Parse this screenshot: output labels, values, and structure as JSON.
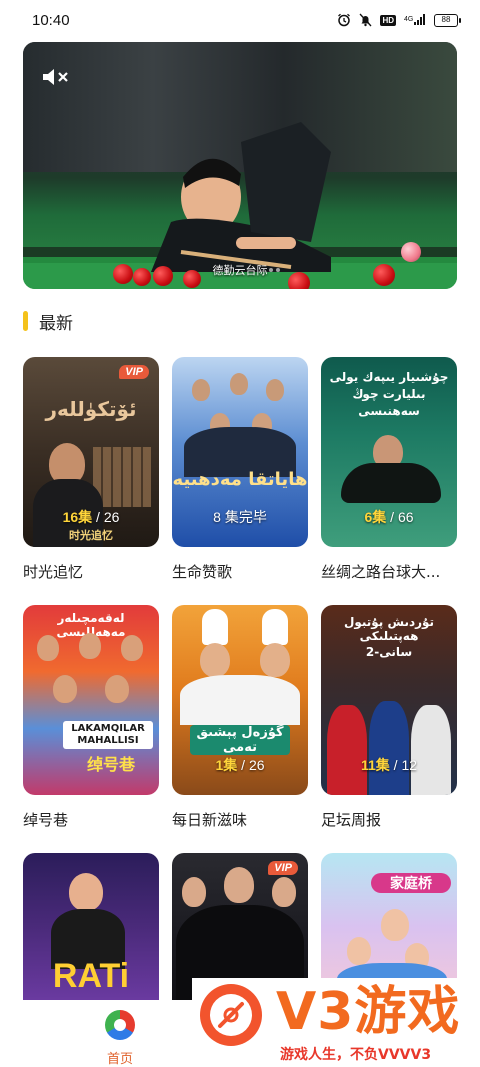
{
  "status_bar": {
    "time": "10:40",
    "network": "⁴⁶ᴳ",
    "hd": "HD",
    "battery": "88"
  },
  "banner": {
    "caption": "德勤云台际"
  },
  "section": {
    "title": "最新"
  },
  "cards": [
    {
      "title": "时光追忆",
      "ep_current": "16",
      "ep_unit": "集",
      "ep_sep": " / ",
      "ep_total": "26",
      "vip": "VIP",
      "poster_text": "时光追忆"
    },
    {
      "title": "生命赞歌",
      "ep_current": "8",
      "ep_unit": "集完毕",
      "ep_sep": "",
      "ep_total": "",
      "vip": ""
    },
    {
      "title": "丝绸之路台球大...",
      "ep_current": "6",
      "ep_unit": "集",
      "ep_sep": " / ",
      "ep_total": "66",
      "vip": ""
    },
    {
      "title": "绰号巷",
      "ep_current": "",
      "ep_unit": "",
      "ep_sep": "",
      "ep_total": "",
      "vip": "",
      "poster_text": "LAKAMQILAR MAHALLISI",
      "poster_sub": "绰号巷"
    },
    {
      "title": "每日新滋味",
      "ep_current": "1",
      "ep_unit": "集",
      "ep_sep": " / ",
      "ep_total": "26",
      "vip": ""
    },
    {
      "title": "足坛周报",
      "ep_current": "11",
      "ep_unit": "集",
      "ep_sep": " / ",
      "ep_total": "12",
      "vip": ""
    },
    {
      "title": "",
      "vip": "",
      "poster_text": "RATi"
    },
    {
      "title": "",
      "vip": "VIP"
    },
    {
      "title": "",
      "vip": "",
      "poster_text": "家庭桥"
    }
  ],
  "bottom_nav": {
    "home_label": "首页"
  },
  "watermark": {
    "brand": "V3游戏",
    "slogan": "游戏人生，不负VVVV3"
  },
  "colors": {
    "accent_yellow": "#f4c21b",
    "home_active": "#e0622c",
    "episode_highlight": "#ffd53a"
  }
}
